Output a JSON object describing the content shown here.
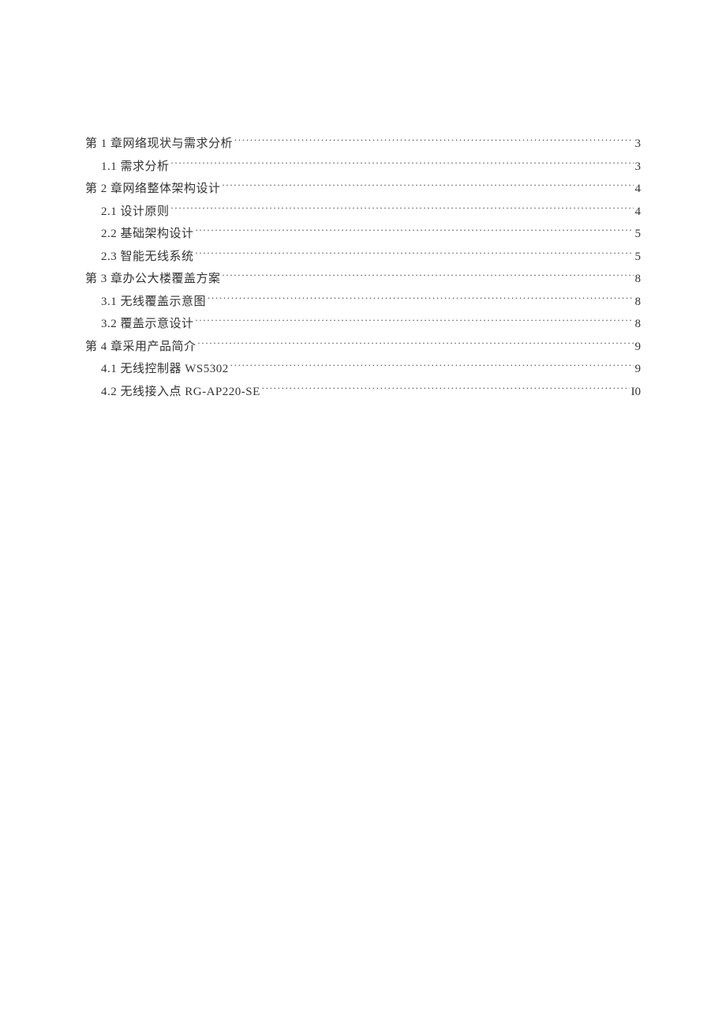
{
  "toc": [
    {
      "level": 1,
      "title": "第 1 章网络现状与需求分析",
      "page": "3"
    },
    {
      "level": 2,
      "title": "1.1 需求分析",
      "page": "3"
    },
    {
      "level": 1,
      "title": "第 2 章网络整体架构设计",
      "page": "4"
    },
    {
      "level": 2,
      "title": "2.1  设计原则",
      "page": "4"
    },
    {
      "level": 2,
      "title": "2.2  基础架构设计",
      "page": "5"
    },
    {
      "level": 2,
      "title": "2.3  智能无线系统",
      "page": "5"
    },
    {
      "level": 1,
      "title": "第 3 章办公大楼覆盖方案",
      "page": "8"
    },
    {
      "level": 2,
      "title": "3.1  无线覆盖示意图",
      "page": "8"
    },
    {
      "level": 2,
      "title": "3.2  覆盖示意设计",
      "page": "8"
    },
    {
      "level": 1,
      "title": "第 4 章采用产品简介",
      "page": "9"
    },
    {
      "level": 2,
      "title": "4.1  无线控制器 WS5302",
      "page": "9"
    },
    {
      "level": 2,
      "title": "4.2  无线接入点 RG-AP220-SE",
      "page": "I0"
    }
  ]
}
